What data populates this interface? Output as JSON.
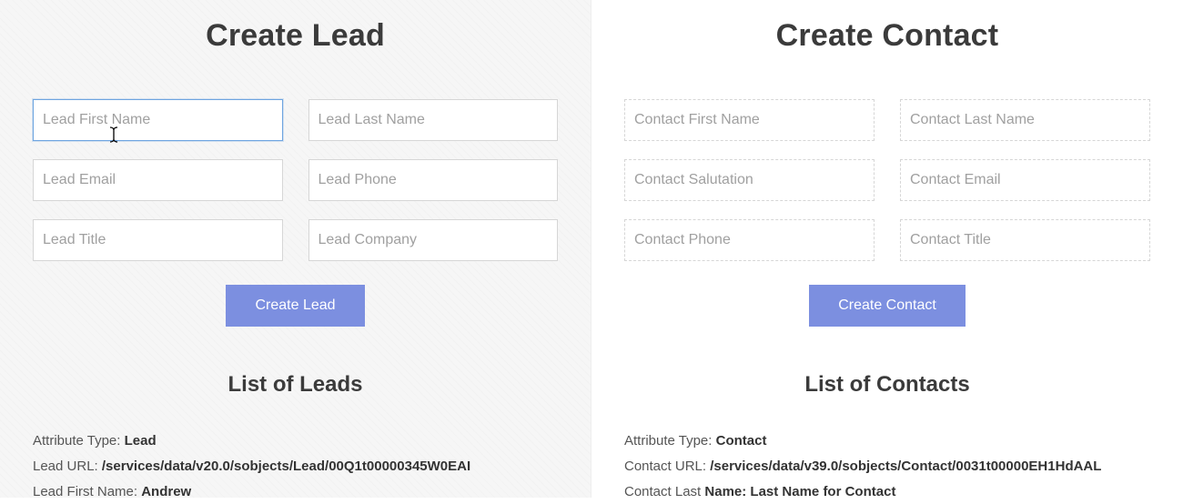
{
  "lead": {
    "heading": "Create Lead",
    "inputs": {
      "first_name": {
        "placeholder": "Lead First Name",
        "value": ""
      },
      "last_name": {
        "placeholder": "Lead Last Name",
        "value": ""
      },
      "email": {
        "placeholder": "Lead Email",
        "value": ""
      },
      "phone": {
        "placeholder": "Lead Phone",
        "value": ""
      },
      "title": {
        "placeholder": "Lead Title",
        "value": ""
      },
      "company": {
        "placeholder": "Lead Company",
        "value": ""
      }
    },
    "button": "Create Lead",
    "list_heading": "List of Leads",
    "details": {
      "attr_label": "Attribute Type: ",
      "attr_value": "Lead",
      "url_label": "Lead URL: ",
      "url_value": "/services/data/v20.0/sobjects/Lead/00Q1t00000345W0EAI",
      "fname_label": "Lead First Name: ",
      "fname_value": "Andrew"
    }
  },
  "contact": {
    "heading": "Create Contact",
    "inputs": {
      "first_name": {
        "placeholder": "Contact First Name",
        "value": ""
      },
      "last_name": {
        "placeholder": "Contact Last Name",
        "value": ""
      },
      "salutation": {
        "placeholder": "Contact Salutation",
        "value": ""
      },
      "email": {
        "placeholder": "Contact Email",
        "value": ""
      },
      "phone": {
        "placeholder": "Contact Phone",
        "value": ""
      },
      "title": {
        "placeholder": "Contact Title",
        "value": ""
      }
    },
    "button": "Create Contact",
    "list_heading": "List of Contacts",
    "details": {
      "attr_label": "Attribute Type: ",
      "attr_value": "Contact",
      "url_label": "Contact URL: ",
      "url_value": "/services/data/v39.0/sobjects/Contact/0031t00000EH1HdAAL",
      "lname_label": "Contact Last ",
      "lname_value": "Name: Last Name for Contact"
    }
  }
}
